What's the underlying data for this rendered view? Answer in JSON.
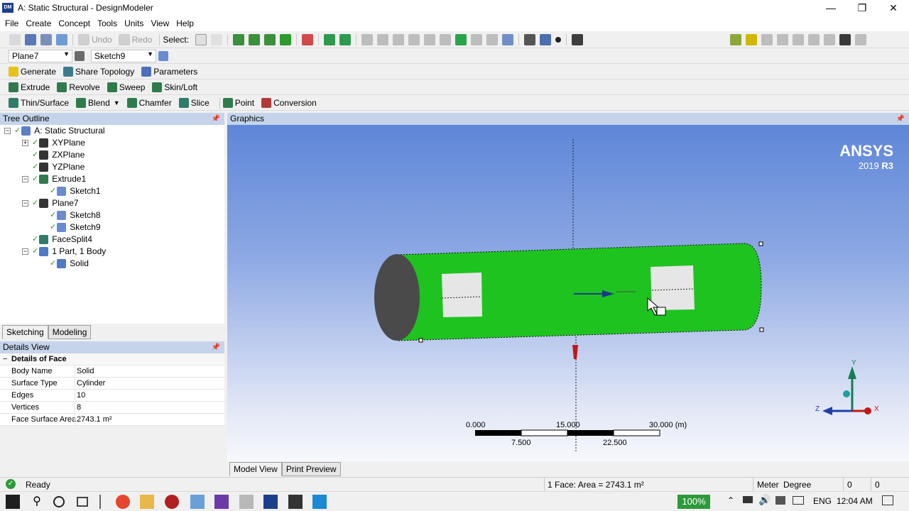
{
  "window": {
    "app_icon": "DM",
    "title": "A: Static Structural - DesignModeler",
    "controls": [
      "minimize-icon",
      "restore-icon",
      "close-icon"
    ]
  },
  "menu": [
    "File",
    "Create",
    "Concept",
    "Tools",
    "Units",
    "View",
    "Help"
  ],
  "toolbar1": {
    "undo": "Undo",
    "redo": "Redo",
    "select": "Select:"
  },
  "toolbar2": {
    "plane_value": "Plane7",
    "sketch_value": "Sketch9"
  },
  "toolbar3": [
    "Generate",
    "Share Topology",
    "Parameters"
  ],
  "toolbar4": [
    "Extrude",
    "Revolve",
    "Sweep",
    "Skin/Loft"
  ],
  "toolbar5": [
    "Thin/Surface",
    "Blend",
    "Chamfer",
    "Slice",
    "Point",
    "Conversion"
  ],
  "tree": {
    "header": "Tree Outline",
    "nodes": [
      {
        "label": "A: Static Structural"
      },
      {
        "label": "XYPlane"
      },
      {
        "label": "ZXPlane"
      },
      {
        "label": "YZPlane"
      },
      {
        "label": "Extrude1"
      },
      {
        "label": "Sketch1"
      },
      {
        "label": "Plane7"
      },
      {
        "label": "Sketch8"
      },
      {
        "label": "Sketch9"
      },
      {
        "label": "FaceSplit4"
      },
      {
        "label": "1 Part, 1 Body"
      },
      {
        "label": "Solid"
      }
    ]
  },
  "left_tabs": [
    "Sketching",
    "Modeling"
  ],
  "details": {
    "header": "Details View",
    "group": "Details of Face",
    "rows": [
      {
        "key": "Body Name",
        "value": "Solid"
      },
      {
        "key": "Surface Type",
        "value": "Cylinder"
      },
      {
        "key": "Edges",
        "value": "10"
      },
      {
        "key": "Vertices",
        "value": "8"
      },
      {
        "key": "Face Surface Area",
        "value": "2743.1 m²"
      }
    ]
  },
  "graphics": {
    "header": "Graphics",
    "brand": "ANSYS",
    "version_prefix": "2019",
    "version_release": "R3",
    "scale_top": [
      "0.000",
      "15.000",
      "30.000 (m)"
    ],
    "scale_bottom": [
      "7.500",
      "22.500"
    ],
    "axes": [
      "Y",
      "Z",
      "X"
    ],
    "colors": {
      "cylinder": "#1fc31f",
      "end_cap": "#4a4a4a",
      "split_face": "#e6e6e6"
    }
  },
  "bottom_tabs": [
    "Model View",
    "Print Preview"
  ],
  "status": {
    "ready": "Ready",
    "selection": "1 Face: Area = 2743.1 m²",
    "unit_length": "Meter",
    "unit_angle": "Degree",
    "field1": "0",
    "field2": "0"
  },
  "taskbar": {
    "zoom": "100%",
    "lang": "ENG",
    "time": "12:04 AM"
  }
}
